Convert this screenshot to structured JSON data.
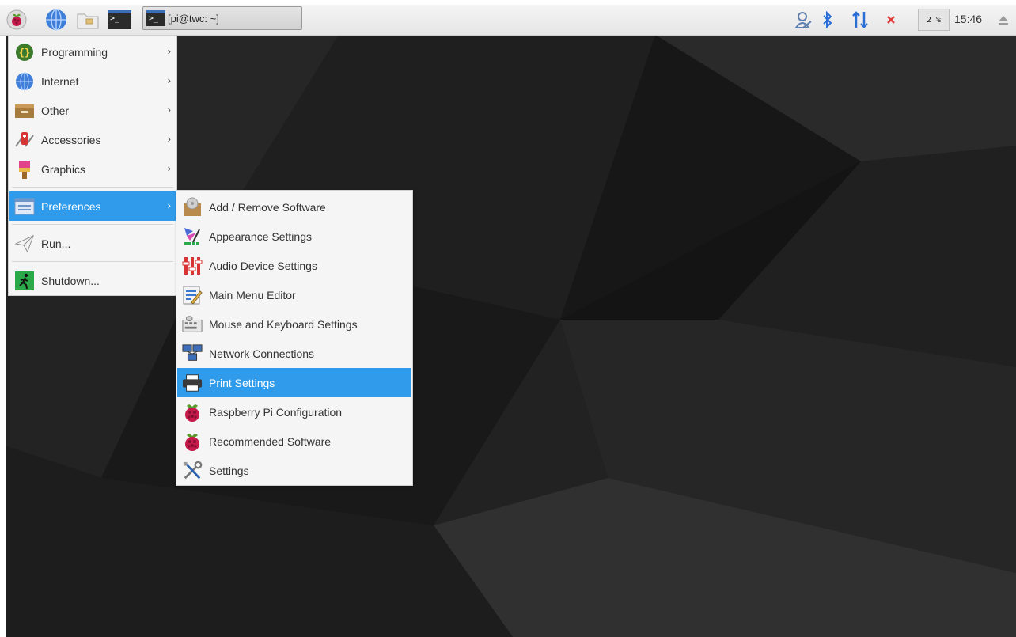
{
  "taskbar": {
    "task_button_label": "[pi@twc: ~]",
    "cpu_label": "2 %",
    "clock": "15:46",
    "icons": [
      "raspberry-icon",
      "web-browser-icon",
      "file-manager-icon",
      "terminal-icon",
      "user-icon",
      "bluetooth-icon",
      "network-icon",
      "volume-muted-icon",
      "eject-icon"
    ]
  },
  "main_menu": {
    "items": [
      {
        "label": "Programming",
        "icon": "programming-icon",
        "submenu": true
      },
      {
        "label": "Internet",
        "icon": "internet-icon",
        "submenu": true
      },
      {
        "label": "Other",
        "icon": "other-icon",
        "submenu": true
      },
      {
        "label": "Accessories",
        "icon": "accessories-icon",
        "submenu": true
      },
      {
        "label": "Graphics",
        "icon": "graphics-icon",
        "submenu": true
      },
      {
        "label": "Preferences",
        "icon": "preferences-icon",
        "submenu": true,
        "selected": true
      },
      {
        "label": "Run...",
        "icon": "run-icon"
      },
      {
        "label": "Shutdown...",
        "icon": "shutdown-icon"
      }
    ]
  },
  "sub_menu": {
    "items": [
      {
        "label": "Add / Remove Software",
        "icon": "package-icon"
      },
      {
        "label": "Appearance Settings",
        "icon": "appearance-icon"
      },
      {
        "label": "Audio Device Settings",
        "icon": "audio-icon"
      },
      {
        "label": "Main Menu Editor",
        "icon": "menu-editor-icon"
      },
      {
        "label": "Mouse and Keyboard Settings",
        "icon": "keyboard-icon"
      },
      {
        "label": "Network Connections",
        "icon": "network-connections-icon"
      },
      {
        "label": "Print Settings",
        "icon": "printer-icon",
        "selected": true
      },
      {
        "label": "Raspberry Pi Configuration",
        "icon": "raspberry-config-icon"
      },
      {
        "label": "Recommended Software",
        "icon": "recommended-icon"
      },
      {
        "label": "Settings",
        "icon": "settings-icon"
      }
    ]
  },
  "colors": {
    "selection": "#2f9bea",
    "desktop": "#1c1c1c",
    "raspberry": "#c51a4a"
  }
}
